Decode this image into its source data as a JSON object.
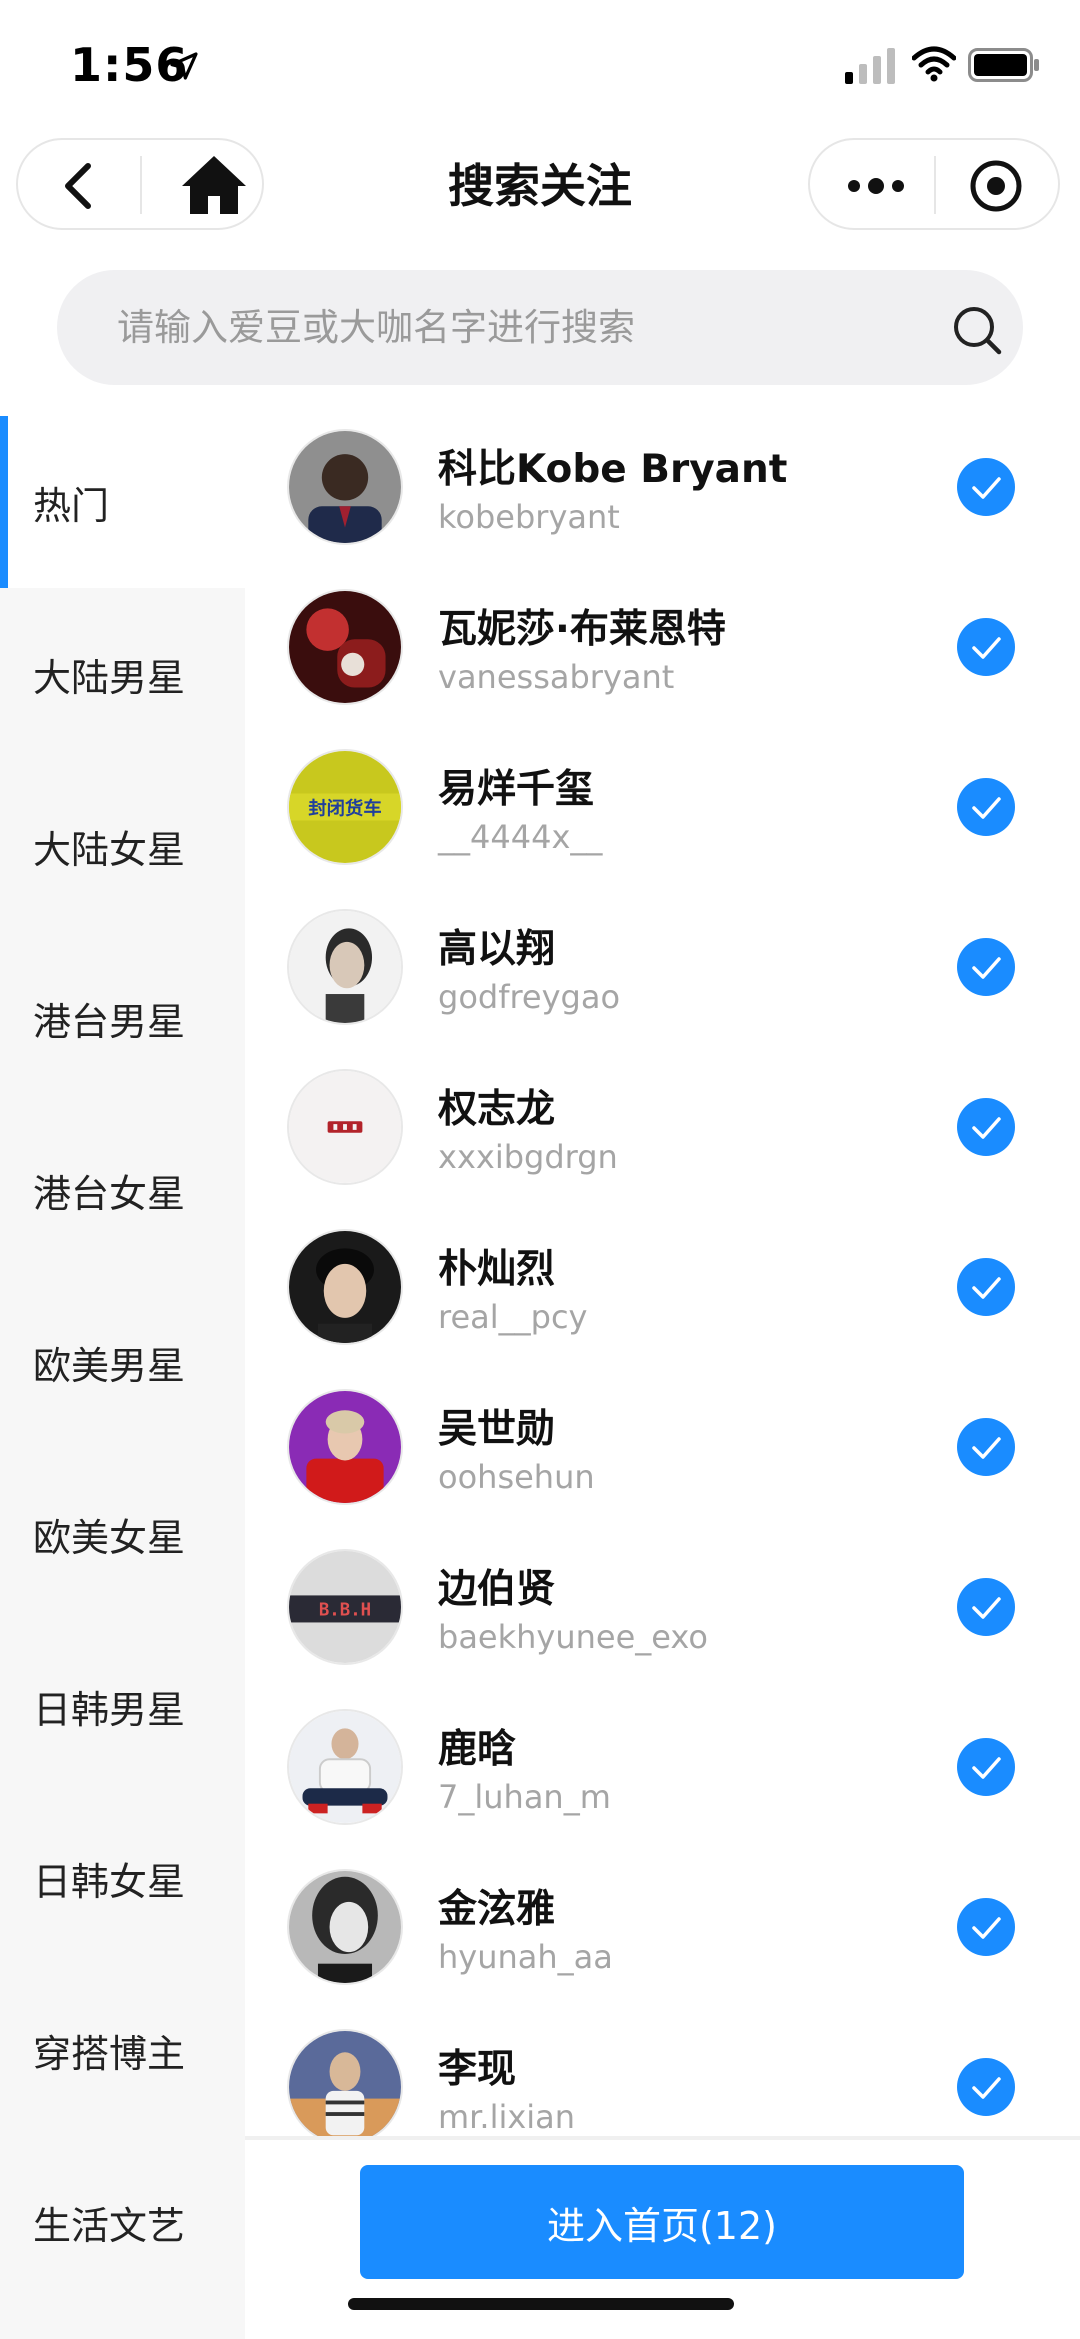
{
  "status_bar": {
    "time": "1:56"
  },
  "nav": {
    "title": "搜索关注"
  },
  "search": {
    "placeholder": "请输入爱豆或大咖名字进行搜索"
  },
  "categories": [
    {
      "label": "热门",
      "active": true
    },
    {
      "label": "大陆男星",
      "active": false
    },
    {
      "label": "大陆女星",
      "active": false
    },
    {
      "label": "港台男星",
      "active": false
    },
    {
      "label": "港台女星",
      "active": false
    },
    {
      "label": "欧美男星",
      "active": false
    },
    {
      "label": "欧美女星",
      "active": false
    },
    {
      "label": "日韩男星",
      "active": false
    },
    {
      "label": "日韩女星",
      "active": false
    },
    {
      "label": "穿搭博主",
      "active": false
    },
    {
      "label": "生活文艺",
      "active": false
    }
  ],
  "celebrities": [
    {
      "name": "科比Kobe Bryant",
      "handle": "kobebryant",
      "checked": true
    },
    {
      "name": "瓦妮莎·布莱恩特",
      "handle": "vanessabryant",
      "checked": true
    },
    {
      "name": "易烊千玺",
      "handle": "__4444x__",
      "checked": true,
      "avatar_text": "封闭货车"
    },
    {
      "name": "高以翔",
      "handle": "godfreygao",
      "checked": true
    },
    {
      "name": "权志龙",
      "handle": "xxxibgdrgn",
      "checked": true
    },
    {
      "name": "朴灿烈",
      "handle": "real__pcy",
      "checked": true
    },
    {
      "name": "吴世勋",
      "handle": "oohsehun",
      "checked": true
    },
    {
      "name": "边伯贤",
      "handle": "baekhyunee_exo",
      "checked": true,
      "avatar_text": "B.B.H"
    },
    {
      "name": "鹿晗",
      "handle": "7_luhan_m",
      "checked": true
    },
    {
      "name": "金泫雅",
      "handle": "hyunah_aa",
      "checked": true
    },
    {
      "name": "李现",
      "handle": "mr.lixian",
      "checked": true
    }
  ],
  "enter_button": {
    "label": "进入首页(12)"
  },
  "colors": {
    "accent": "#1a8cff",
    "sidebar_bg": "#f7f7f7",
    "handle_text": "#a5a5a5"
  }
}
